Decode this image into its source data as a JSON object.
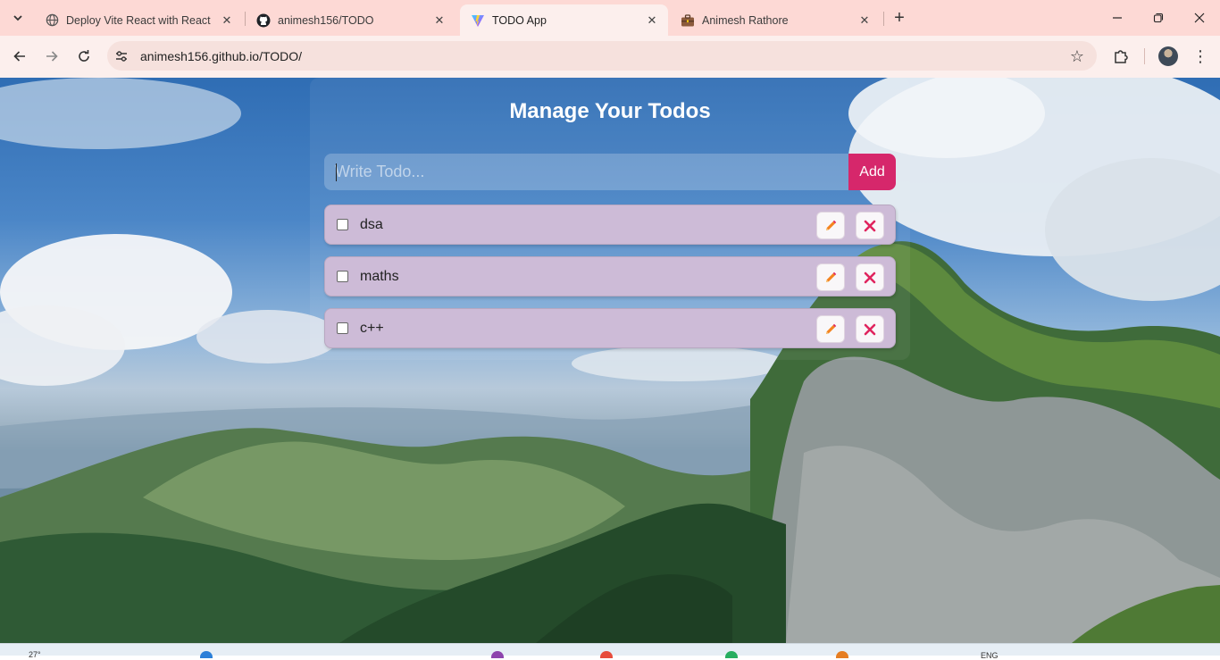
{
  "browser": {
    "tabs": [
      {
        "title": "Deploy Vite React with React Ro",
        "favicon": "globe-icon",
        "active": false
      },
      {
        "title": "animesh156/TODO",
        "favicon": "github-icon",
        "active": false
      },
      {
        "title": "TODO App",
        "favicon": "vite-icon",
        "active": true
      },
      {
        "title": "Animesh Rathore",
        "favicon": "briefcase-icon",
        "active": false
      }
    ],
    "url": "animesh156.github.io/TODO/"
  },
  "app": {
    "title": "Manage Your Todos",
    "input_placeholder": "Write Todo...",
    "add_label": "Add",
    "todos": [
      {
        "text": "dsa",
        "completed": false
      },
      {
        "text": "maths",
        "completed": false
      },
      {
        "text": "c++",
        "completed": false
      }
    ]
  },
  "colors": {
    "accent": "#d6276b",
    "todo_bg": "#cdbbd7",
    "edit_icon": "#f4831f",
    "delete_icon": "#e0245e"
  },
  "taskbar": {
    "weather": "27°",
    "language": "ENG"
  }
}
